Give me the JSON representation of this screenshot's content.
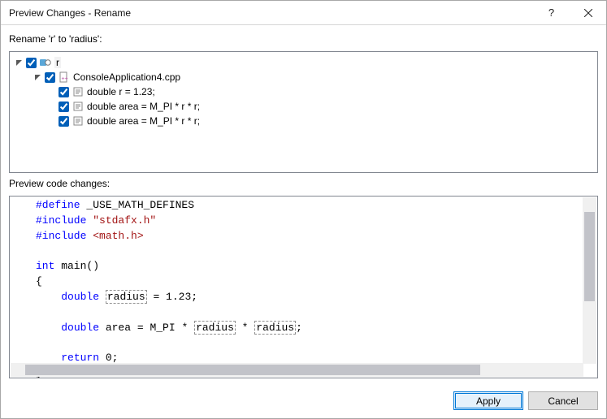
{
  "title": "Preview Changes - Rename",
  "instruction": "Rename 'r' to 'radius':",
  "tree": {
    "root": {
      "label": "r"
    },
    "file": {
      "label": "ConsoleApplication4.cpp"
    },
    "lines": [
      {
        "label": "double r = 1.23;"
      },
      {
        "label": "double area = M_PI * r * r;"
      },
      {
        "label": "double area = M_PI * r * r;"
      }
    ]
  },
  "preview_label": "Preview code changes:",
  "code": {
    "l1_a": "#define",
    "l1_b": " _USE_MATH_DEFINES",
    "l2_a": "#include",
    "l2_b": " \"stdafx.h\"",
    "l3_a": "#include",
    "l3_b": " <math.h>",
    "l4_a": "int",
    "l4_b": " main()",
    "l5": "{",
    "l6_a": "    ",
    "l6_b": "double",
    "l6_c": " ",
    "l6_d": "radius",
    "l6_e": " = 1.23;",
    "l7_a": "    ",
    "l7_b": "double",
    "l7_c": " area = M_PI * ",
    "l7_d": "radius",
    "l7_e": " * ",
    "l7_f": "radius",
    "l7_g": ";",
    "l8_a": "    ",
    "l8_b": "return",
    "l8_c": " 0;",
    "l9": "}"
  },
  "buttons": {
    "apply": "Apply",
    "cancel": "Cancel"
  }
}
